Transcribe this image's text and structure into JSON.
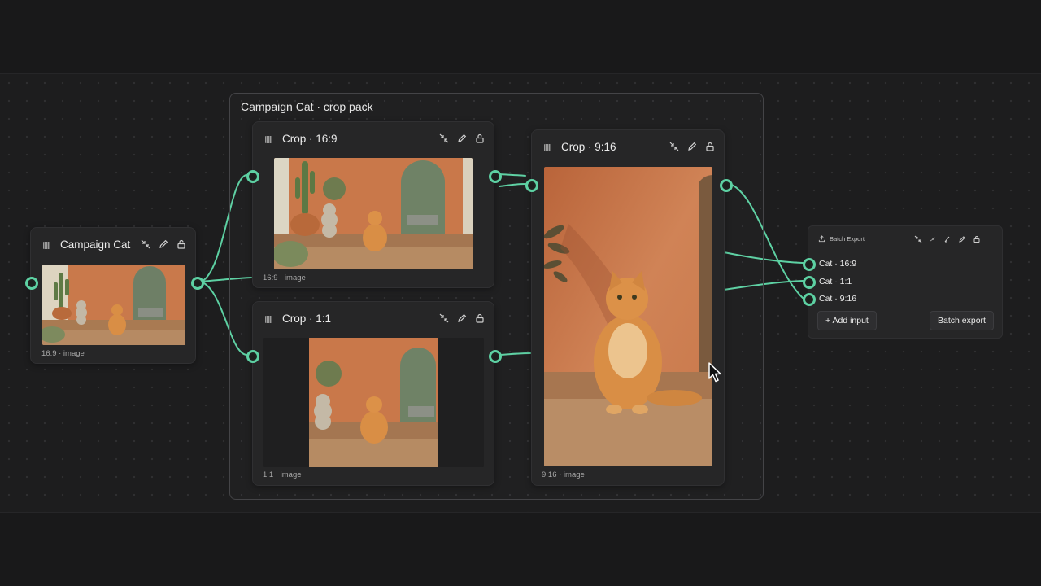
{
  "group": {
    "title": "Campaign Cat · crop pack"
  },
  "nodes": {
    "source": {
      "title": "Campaign Cat",
      "caption": "16:9 · image"
    },
    "crop169": {
      "title": "Crop · 16:9",
      "caption": "16:9 · image"
    },
    "crop11": {
      "title": "Crop · 1:1",
      "caption": "1:1 · image"
    },
    "crop916": {
      "title": "Crop · 9:16",
      "caption": "9:16 · image"
    }
  },
  "export": {
    "title": "Batch Export",
    "inputs": [
      "Cat · 16:9",
      "Cat · 1:1",
      "Cat · 9:16"
    ],
    "add_input_label": "+ Add input",
    "batch_export_label": "Batch export",
    "more_label": "··"
  },
  "icons": {
    "node_tools": [
      "collapse-icon",
      "edit-icon",
      "lock-icon"
    ],
    "export_tools": [
      "collapse-icon",
      "hide-icon",
      "brush-icon",
      "edit-icon",
      "lock-icon"
    ]
  },
  "colors": {
    "canvas": "#1d1d1e",
    "node": "#262627",
    "wire": "#5dd1a3",
    "terracotta_wall": "#c8774a",
    "cat": "#d98e45"
  }
}
